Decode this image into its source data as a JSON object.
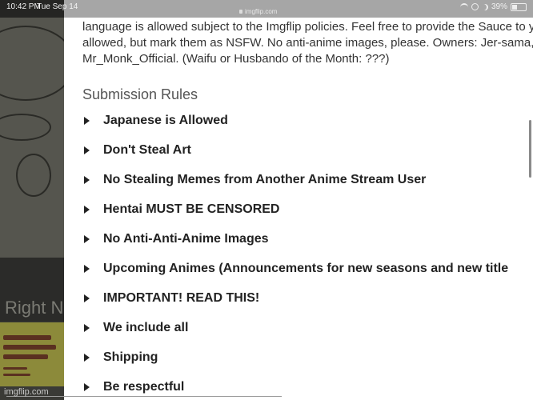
{
  "status_bar": {
    "time": "10:42 PM",
    "date": "Tue Sep 14",
    "url": "imgflip.com",
    "battery": "39%"
  },
  "background_page": {
    "partial_text": "Right N"
  },
  "content": {
    "intro_lines": [
      "language is allowed subject to the Imgflip policies. Feel free to provide the Sauce to yo",
      "allowed, but mark them as NSFW. No anti-anime images, please. Owners: Jer-sama, I",
      "Mr_Monk_Official. (Waifu or Husbando of the Month: ???)"
    ],
    "section_title": "Submission Rules",
    "rules": [
      "Japanese is Allowed",
      "Don't Steal Art",
      "No Stealing Memes from Another Anime Stream User",
      "Hentai MUST BE CENSORED",
      "No Anti-Anti-Anime Images",
      "Upcoming Animes (Announcements for new seasons and new title",
      "IMPORTANT! READ THIS!",
      "We include all",
      "Shipping",
      "Be respectful"
    ]
  },
  "watermark": "imgflip.com"
}
